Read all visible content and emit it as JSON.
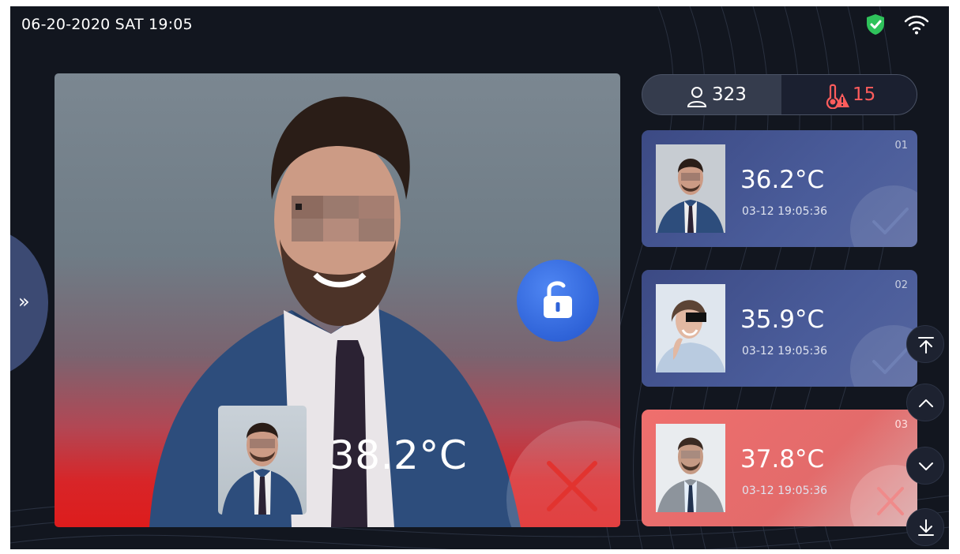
{
  "status_bar": {
    "datetime": "06-20-2020 SAT 19:05",
    "security_icon": "shield-check-icon",
    "network_icon": "wifi-icon"
  },
  "camera_view": {
    "current_temperature": "38.2°C",
    "lock_state_icon": "unlocked-padlock-icon",
    "result_icon": "cross-icon",
    "alert_color": "#dd1c1c"
  },
  "drawer": {
    "toggle_icon": "double-chevron-right-icon",
    "toggle_label": "»"
  },
  "counters": {
    "people_count": "323",
    "people_icon": "person-icon",
    "fever_count": "15",
    "fever_icon": "thermometer-warning-icon",
    "fever_color": "#ff5c5c"
  },
  "records": [
    {
      "index": "01",
      "temperature": "36.2°C",
      "time": "03-12 19:05:36",
      "status": "normal",
      "mark_icon": "check-icon"
    },
    {
      "index": "02",
      "temperature": "35.9°C",
      "time": "03-12 19:05:36",
      "status": "normal",
      "mark_icon": "check-icon"
    },
    {
      "index": "03",
      "temperature": "37.8°C",
      "time": "03-12 19:05:36",
      "status": "abnormal",
      "mark_icon": "cross-icon"
    }
  ],
  "scroll_controls": {
    "top_icon": "scroll-to-top-icon",
    "up_icon": "chevron-up-icon",
    "down_icon": "chevron-down-icon",
    "bottom_icon": "scroll-to-bottom-icon"
  }
}
